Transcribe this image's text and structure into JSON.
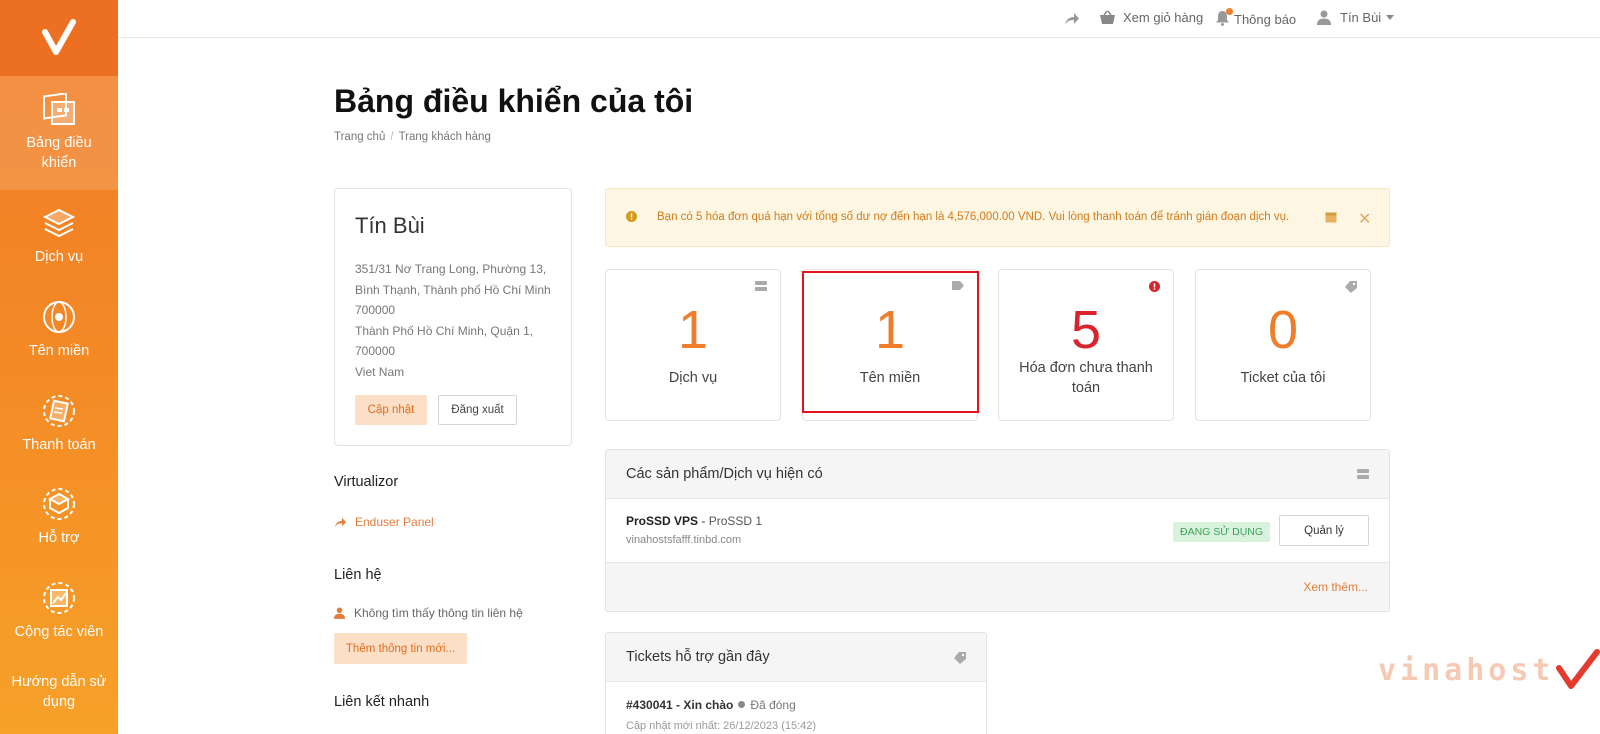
{
  "sidebar": {
    "items": [
      {
        "label": "Bảng điều khiển",
        "icon": "dashboard-icon",
        "active": true
      },
      {
        "label": "Dịch vụ",
        "icon": "services-icon"
      },
      {
        "label": "Tên miền",
        "icon": "domain-icon"
      },
      {
        "label": "Thanh toán",
        "icon": "billing-icon"
      },
      {
        "label": "Hỗ trợ",
        "icon": "support-icon"
      },
      {
        "label": "Cộng tác viên",
        "icon": "affiliate-icon"
      },
      {
        "label": "Hướng dẫn sử dụng",
        "icon": "guide-icon"
      }
    ]
  },
  "topbar": {
    "cart_label": "Xem giỏ hàng",
    "notifications_label": "Thông báo",
    "user_label": "Tín Bùi"
  },
  "page": {
    "title": "Bảng điều khiển của tôi",
    "breadcrumb": [
      "Trang chủ",
      "Trang khách hàng"
    ]
  },
  "profile": {
    "name": "Tín Bùi",
    "address_lines": [
      "351/31 Nơ Trang Long, Phường 13,",
      "Bình Thạnh, Thành phố Hồ Chí Minh",
      "700000",
      "Thành Phố Hồ Chí Minh, Quận 1,",
      "700000",
      "Viet Nam"
    ],
    "update_label": "Cập nhật",
    "logout_label": "Đăng xuất"
  },
  "side": {
    "virtualizor_heading": "Virtualizor",
    "enduser_label": "Enduser Panel",
    "contact_heading": "Liên hệ",
    "no_contact_label": "Không tìm thấy thông tin liên hệ",
    "add_contact_label": "Thêm thông tin mới...",
    "quicklinks_heading": "Liên kết nhanh"
  },
  "alert": {
    "message": "Bạn có 5 hóa đơn quá hạn với tổng số dư nợ đến hạn là 4,576,000.00 VND. Vui lòng thanh toán để tránh gián đoạn dịch vụ."
  },
  "stats": [
    {
      "value": "1",
      "label": "Dịch vụ",
      "icon": "server-icon"
    },
    {
      "value": "1",
      "label": "Tên miền",
      "icon": "tag-icon"
    },
    {
      "value": "5",
      "label": "Hóa đơn chưa thanh toán",
      "icon": "alert-icon"
    },
    {
      "value": "0",
      "label": "Ticket của tôi",
      "icon": "ticket-icon"
    }
  ],
  "products": {
    "title": "Các sản phẩm/Dịch vụ hiện có",
    "rows": [
      {
        "name": "ProSSD VPS",
        "plan": "ProSSD 1",
        "domain": "vinahostsfafff.tinbd.com",
        "status": "ĐANG SỬ DỤNG",
        "manage_label": "Quản lý"
      }
    ],
    "see_more_label": "Xem thêm..."
  },
  "tickets": {
    "title": "Tickets hỗ trợ gần đây",
    "rows": [
      {
        "id_subject": "#430041 - Xin chào",
        "status": "Đã đóng",
        "updated": "Cập nhật mới nhất: 26/12/2023 (15:42)"
      }
    ]
  },
  "watermark": {
    "text": "vinahost"
  },
  "colors": {
    "brand_orange": "#f07a26",
    "number_orange": "#ef7d2a",
    "alert_red": "#d9242d",
    "active_green": "#3aa356"
  }
}
